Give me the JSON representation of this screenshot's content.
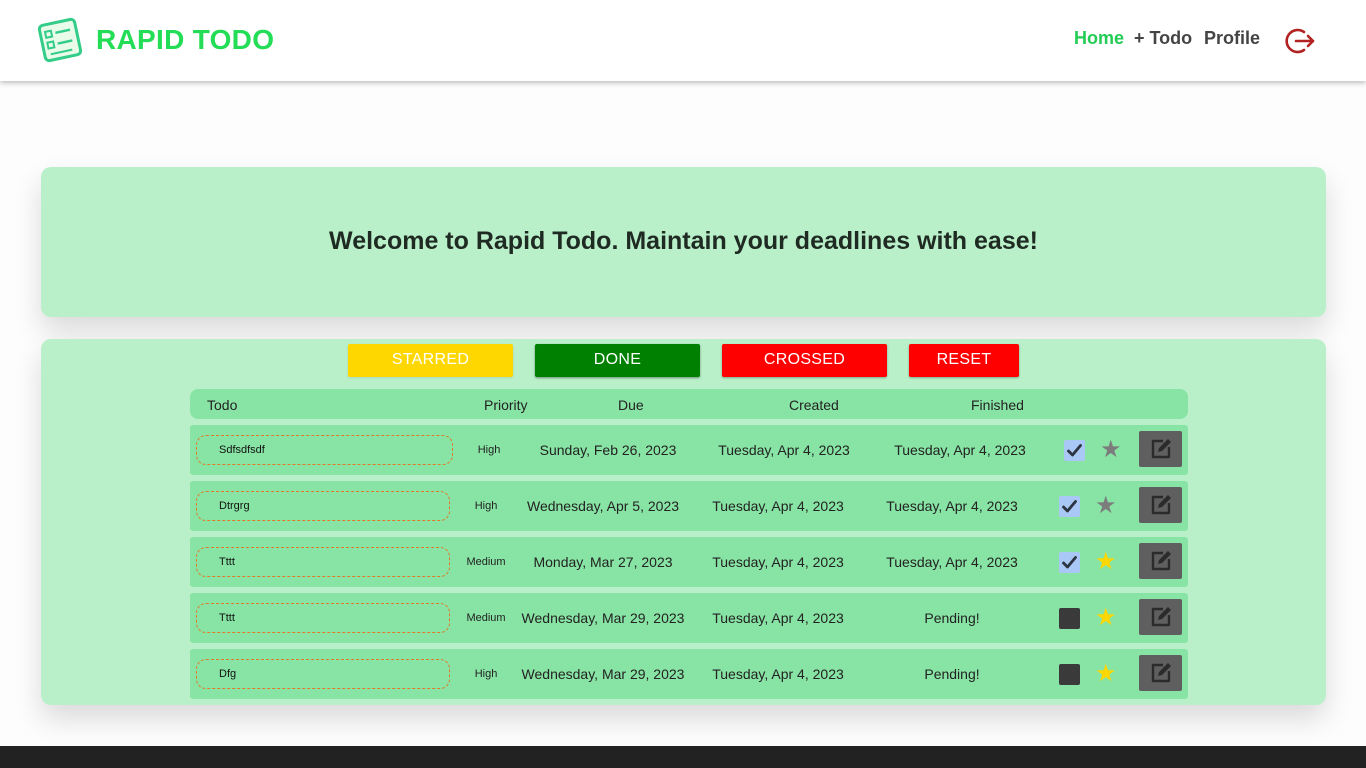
{
  "header": {
    "brand": "RAPID TODO",
    "nav": {
      "home": "Home",
      "add_todo": "+ Todo",
      "profile": "Profile"
    }
  },
  "welcome": {
    "message": "Welcome to Rapid Todo. Maintain your deadlines with ease!"
  },
  "filters": {
    "starred": "STARRED",
    "done": "DONE",
    "crossed": "CROSSED",
    "reset": "RESET"
  },
  "table": {
    "headers": {
      "todo": "Todo",
      "priority": "Priority",
      "due": "Due",
      "created": "Created",
      "finished": "Finished"
    },
    "rows": [
      {
        "todo": "Sdfsdfsdf",
        "priority": "High",
        "due": "Sunday, Feb 26, 2023",
        "created": "Tuesday, Apr 4, 2023",
        "finished": "Tuesday, Apr 4, 2023",
        "done": true,
        "starred": false
      },
      {
        "todo": "Dtrgrg",
        "priority": "High",
        "due": "Wednesday, Apr 5, 2023",
        "created": "Tuesday, Apr 4, 2023",
        "finished": "Tuesday, Apr 4, 2023",
        "done": true,
        "starred": false
      },
      {
        "todo": "Tttt",
        "priority": "Medium",
        "due": "Monday, Mar 27, 2023",
        "created": "Tuesday, Apr 4, 2023",
        "finished": "Tuesday, Apr 4, 2023",
        "done": true,
        "starred": true
      },
      {
        "todo": "Tttt",
        "priority": "Medium",
        "due": "Wednesday, Mar 29, 2023",
        "created": "Tuesday, Apr 4, 2023",
        "finished": "Pending!",
        "done": false,
        "starred": true
      },
      {
        "todo": "Dfg",
        "priority": "High",
        "due": "Wednesday, Mar 29, 2023",
        "created": "Tuesday, Apr 4, 2023",
        "finished": "Pending!",
        "done": false,
        "starred": true
      }
    ]
  },
  "icons": {
    "logo": "checklist-logo-icon",
    "logout": "logout-icon",
    "check": "checkmark-icon",
    "star": "star-icon",
    "edit": "edit-icon"
  },
  "colors": {
    "brand": "#22dd55",
    "panel": "#b9f0c9",
    "row": "#88e4a4",
    "starred": "#ffd700",
    "done": "#008000",
    "crossed": "#ff0000",
    "reset": "#ff0000"
  }
}
